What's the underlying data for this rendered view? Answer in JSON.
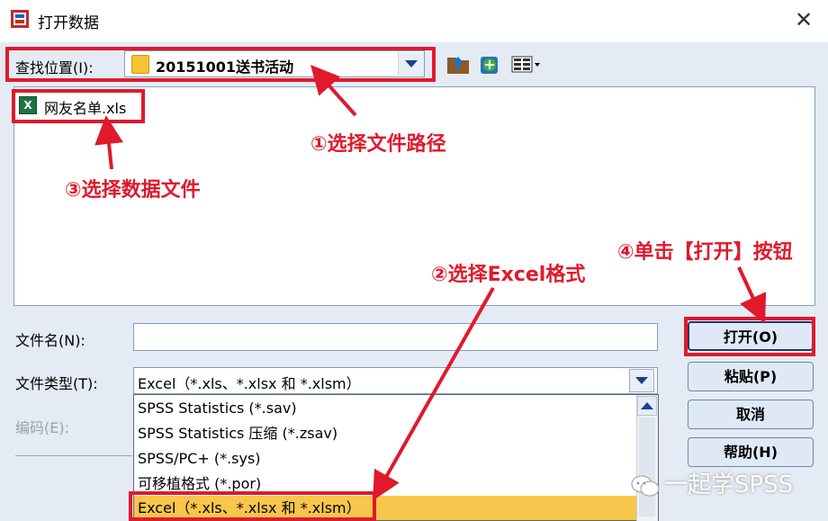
{
  "window": {
    "title": "打开数据",
    "close_glyph": "✕"
  },
  "lookin": {
    "label": "查找位置(I):",
    "value": "20151001送书活动"
  },
  "toolbar_icons": [
    "up-folder-icon",
    "new-folder-icon",
    "view-menu-icon"
  ],
  "file_list": {
    "items": [
      {
        "name": "网友名单.xls",
        "icon": "excel-file-icon"
      }
    ]
  },
  "filename": {
    "label": "文件名(N):",
    "value": ""
  },
  "filetype": {
    "label": "文件类型(T):",
    "value": "Excel（*.xls、*.xlsx 和 *.xlsm）"
  },
  "encoding": {
    "label": "编码(E):"
  },
  "filetype_options": [
    "SPSS Statistics (*.sav)",
    "SPSS Statistics 压缩 (*.zsav)",
    "SPSS/PC+ (*.sys)",
    "可移植格式 (*.por)",
    "Excel（*.xls、*.xlsx 和 *.xlsm）"
  ],
  "selected_option_index": 4,
  "buttons": {
    "open": "打开(O)",
    "paste": "粘贴(P)",
    "cancel": "取消",
    "help": "帮助(H)"
  },
  "annotations": {
    "step1": "①选择文件路径",
    "step2": "②选择Excel格式",
    "step3": "③选择数据文件",
    "step4": "④单击【打开】按钮"
  },
  "watermark": "一起学SPSS",
  "colors": {
    "annotation_red": "#e0192c",
    "dialog_bg": "#e4ebf5",
    "selected_option_bg": "#f7c64a",
    "button_bg": "#dfe9f6"
  }
}
